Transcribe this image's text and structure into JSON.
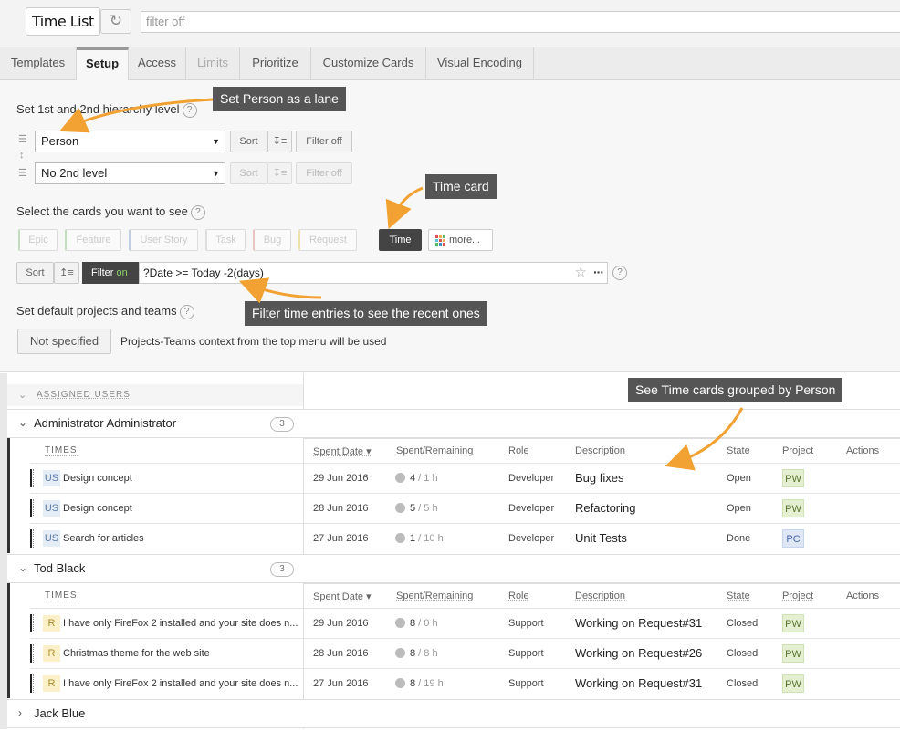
{
  "topbar": {
    "view_title": "Time List",
    "refresh_icon": "refresh-icon",
    "filter_placeholder": "filter off"
  },
  "tabs": [
    {
      "label": "Templates",
      "state": "normal"
    },
    {
      "label": "Setup",
      "state": "active"
    },
    {
      "label": "Access",
      "state": "normal"
    },
    {
      "label": "Limits",
      "state": "disabled"
    },
    {
      "label": "Prioritize",
      "state": "normal"
    },
    {
      "label": "Customize Cards",
      "state": "normal"
    },
    {
      "label": "Visual Encoding",
      "state": "normal"
    }
  ],
  "setup": {
    "hierarchy_label": "Set 1st and 2nd hierarchy level",
    "level1": {
      "value": "Person",
      "sort": "Sort",
      "filter": "Filter off"
    },
    "level2": {
      "value": "No 2nd level",
      "sort": "Sort",
      "filter": "Filter off"
    },
    "cards_label": "Select the cards you want to see",
    "card_types": [
      "Epic",
      "Feature",
      "User Story",
      "Task",
      "Bug",
      "Request"
    ],
    "time_label": "Time",
    "more_label": "more...",
    "sort_label": "Sort",
    "filter_on_prefix": "Filter",
    "filter_on_state": "on",
    "filter_value": "?Date >= Today -2(days)",
    "defaults_label": "Set default projects and teams",
    "not_specified": "Not specified",
    "context_note": "Projects-Teams context from the top menu will be used",
    "help": "?"
  },
  "callouts": {
    "person_lane": "Set Person as a lane",
    "time_card": "Time card",
    "filter_recent": "Filter time entries to see the recent ones",
    "grouped": "See Time cards grouped by Person"
  },
  "board": {
    "assigned_header": "ASSIGNED USERS",
    "columns": {
      "times": "TIMES",
      "spent_date": "Spent Date ▾",
      "spent_remaining": "Spent/Remaining",
      "role": "Role",
      "description": "Description",
      "state": "State",
      "project": "Project",
      "actions": "Actions"
    },
    "lanes": [
      {
        "name": "Administrator Administrator",
        "count": "3",
        "rows": [
          {
            "type": "US",
            "title": "Design concept",
            "date": "29 Jun 2016",
            "spent": "4",
            "remaining": " / 1 h",
            "role": "Developer",
            "desc": "Bug fixes",
            "state": "Open",
            "project": "PW"
          },
          {
            "type": "US",
            "title": "Design concept",
            "date": "28 Jun 2016",
            "spent": "5",
            "remaining": " / 5 h",
            "role": "Developer",
            "desc": "Refactoring",
            "state": "Open",
            "project": "PW"
          },
          {
            "type": "US",
            "title": "Search for articles",
            "date": "27 Jun 2016",
            "spent": "1",
            "remaining": " / 10 h",
            "role": "Developer",
            "desc": "Unit Tests",
            "state": "Done",
            "project": "PC"
          }
        ]
      },
      {
        "name": "Tod Black",
        "count": "3",
        "rows": [
          {
            "type": "R",
            "title": "I have only FireFox 2 installed and your site does n...",
            "date": "29 Jun 2016",
            "spent": "8",
            "remaining": " / 0 h",
            "role": "Support",
            "desc": "Working on Request#31",
            "state": "Closed",
            "project": "PW"
          },
          {
            "type": "R",
            "title": "Christmas theme for the web site",
            "date": "28 Jun 2016",
            "spent": "8",
            "remaining": " / 8 h",
            "role": "Support",
            "desc": "Working on Request#26",
            "state": "Closed",
            "project": "PW"
          },
          {
            "type": "R",
            "title": "I have only FireFox 2 installed and your site does n...",
            "date": "27 Jun 2016",
            "spent": "8",
            "remaining": " / 19 h",
            "role": "Support",
            "desc": "Working on Request#31",
            "state": "Closed",
            "project": "PW"
          }
        ]
      },
      {
        "name": "Jack Blue"
      }
    ]
  },
  "colors": {
    "callout_bg": "#555555",
    "arrow": "#f2a233",
    "dark_button": "#444444",
    "filter_on_green": "#8fd16a",
    "project_pw": "#e5f0d3",
    "project_pc": "#dfe7f7",
    "user_story_badge": "#e4ecf6",
    "request_badge": "#fbf0c9"
  }
}
